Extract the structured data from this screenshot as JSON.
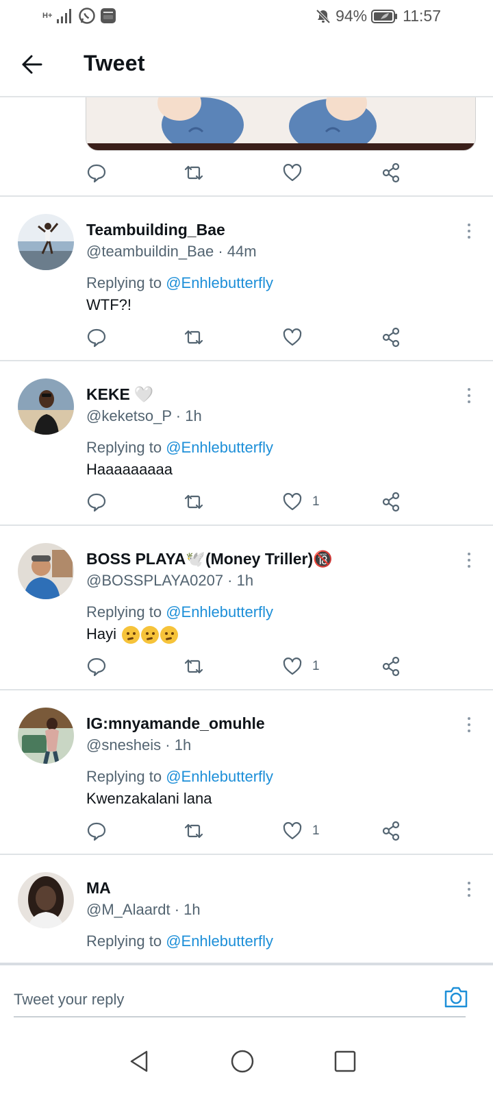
{
  "status_bar": {
    "network_label": "H+",
    "battery_percent": "94%",
    "time": "11:57"
  },
  "header": {
    "title": "Tweet"
  },
  "top_tweet_actions": {
    "reply_count": "",
    "retweet_count": "",
    "like_count": ""
  },
  "replies": [
    {
      "name": "Teambuilding_Bae",
      "handle_time": "@teambuildin_Bae · 44m",
      "replying_prefix": "Replying to ",
      "replying_mention": "@Enhlebutterfly",
      "text": "WTF?!",
      "like_count": "",
      "avatar_colors": [
        "#9ab3c9",
        "#6b7d8c",
        "#e9eef3"
      ]
    },
    {
      "name": "KEKE",
      "name_suffix": "🤍",
      "handle_time": "@keketso_P · 1h",
      "replying_prefix": "Replying to ",
      "replying_mention": "@Enhlebutterfly",
      "text": "Haaaaaaaaa",
      "like_count": "1",
      "avatar_colors": [
        "#d9c7a8",
        "#3c2a1e",
        "#8aa3b9"
      ]
    },
    {
      "name": "BOSS PLAYA🕊️(Money Triller)🔞",
      "handle_time": "@BOSSPLAYA0207 · 1h",
      "replying_prefix": "Replying to ",
      "replying_mention": "@Enhlebutterfly",
      "text": "Hayi",
      "emoji_count": 3,
      "like_count": "1",
      "avatar_colors": [
        "#e2ddd6",
        "#2e6fb7",
        "#b08a6a"
      ]
    },
    {
      "name": "IG:mnyamande_omuhle",
      "handle_time": "@snesheis · 1h",
      "replying_prefix": "Replying to ",
      "replying_mention": "@Enhlebutterfly",
      "text": "Kwenzakalani lana",
      "like_count": "1",
      "avatar_colors": [
        "#4a7a5c",
        "#7a5a3a",
        "#c9d6c4"
      ]
    },
    {
      "name": "MA",
      "handle_time": "@M_Alaardt · 1h",
      "replying_prefix": "Replying to ",
      "replying_mention": "@Enhlebutterfly",
      "text": "",
      "like_count": "",
      "avatar_colors": [
        "#5a4032",
        "#2a1d17",
        "#e8e3de"
      ]
    }
  ],
  "composer": {
    "placeholder": "Tweet your reply"
  },
  "icons": {
    "reply": "reply-icon",
    "retweet": "retweet-icon",
    "like": "like-icon",
    "share": "share-icon",
    "camera": "camera-icon",
    "back": "back-arrow-icon"
  },
  "colors": {
    "accent": "#1d8fd8",
    "text_secondary": "#536471",
    "divider": "#dfe3e6"
  }
}
